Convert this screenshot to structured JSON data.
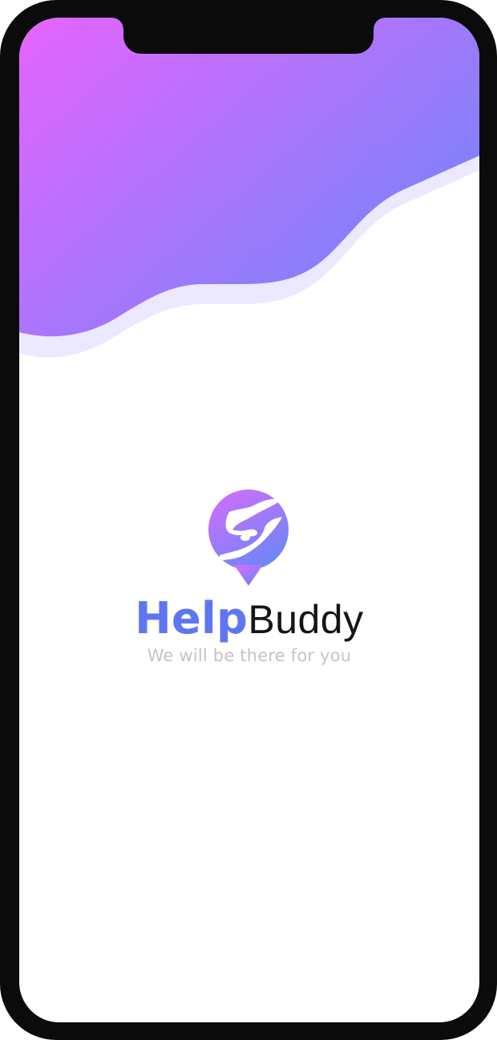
{
  "app": {
    "brand_part1": "Help",
    "brand_part2": "Buddy",
    "tagline": "We will be there for you",
    "logo_icon": "helping-hands-chat-bubble-icon"
  },
  "colors": {
    "gradient_start": "#e764ff",
    "gradient_end": "#6f86f8",
    "brand_blue": "#5f76f2",
    "tagline_gray": "#c4c4c4",
    "frame": "#0b0b0b"
  }
}
